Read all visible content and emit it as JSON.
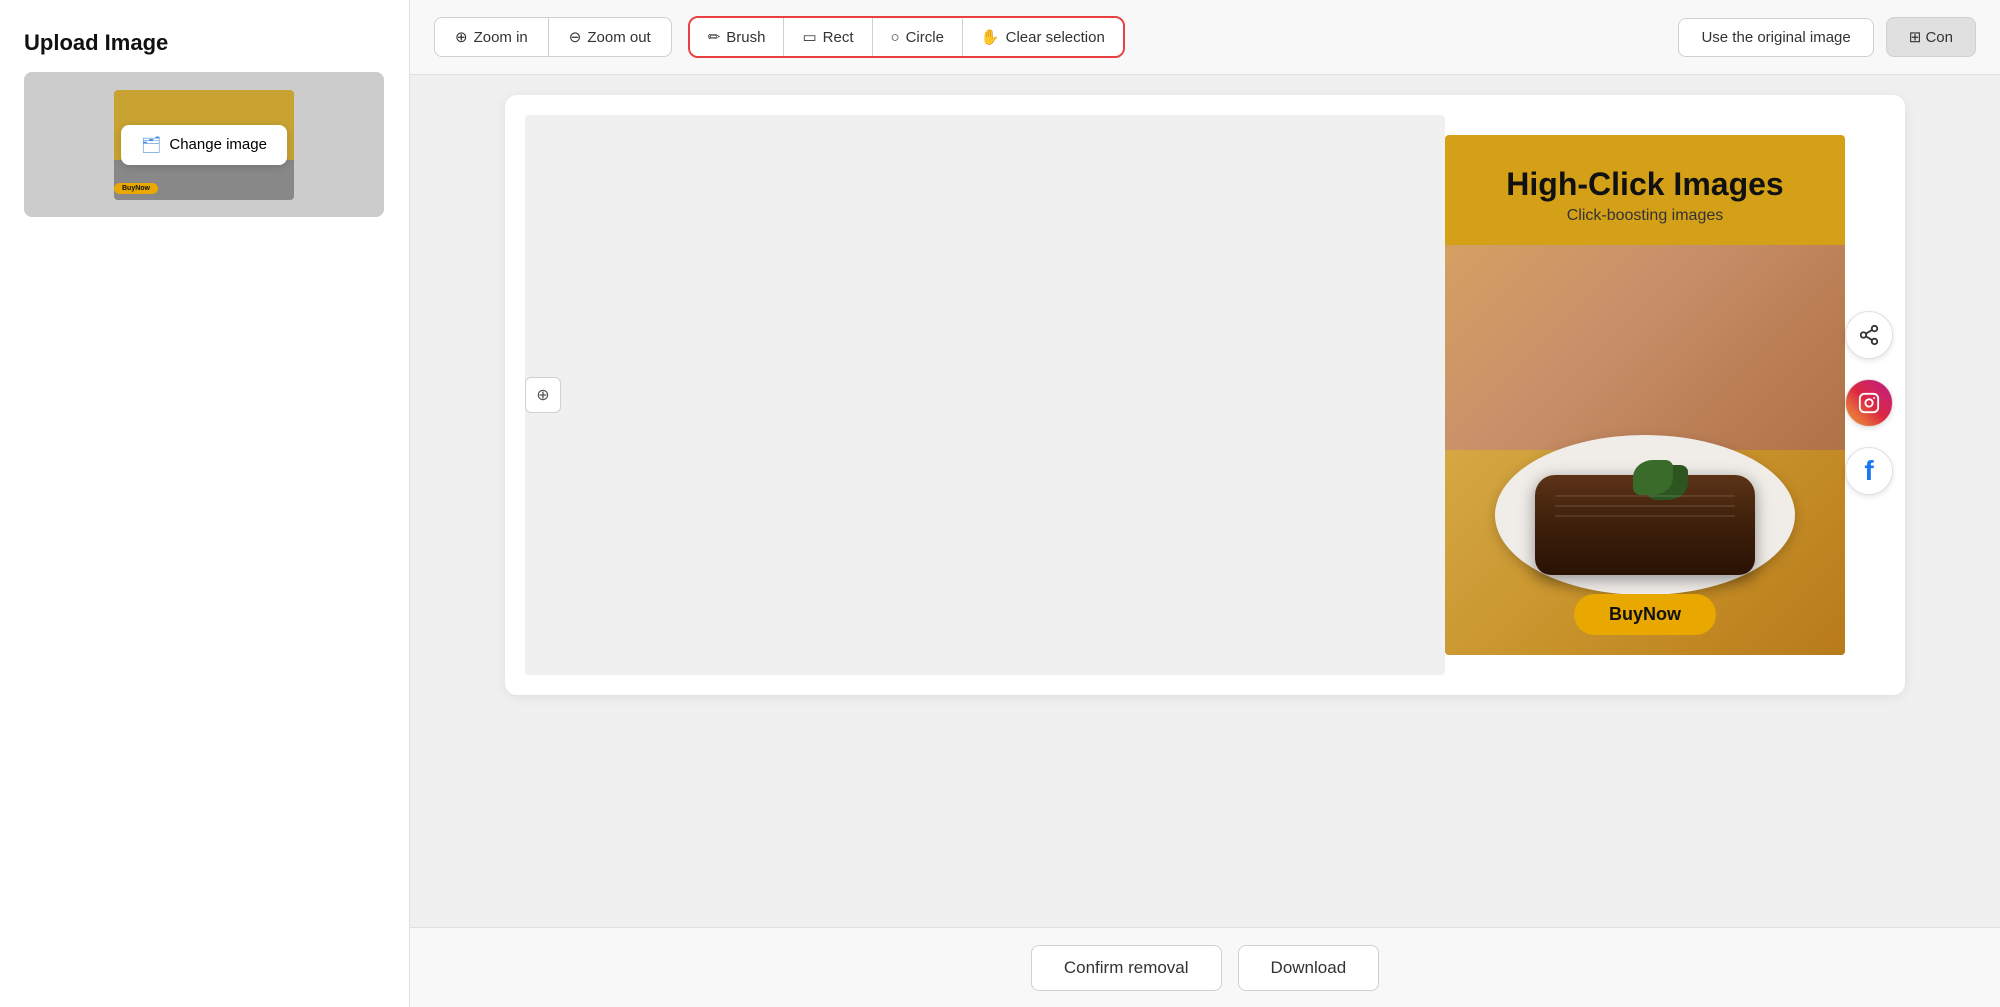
{
  "sidebar": {
    "title": "Upload Image",
    "change_image_label": "Change image"
  },
  "toolbar": {
    "zoom_in_label": "Zoom in",
    "zoom_out_label": "Zoom out",
    "brush_label": "Brush",
    "rect_label": "Rect",
    "circle_label": "Circle",
    "clear_selection_label": "Clear selection",
    "use_original_label": "Use the original image",
    "operation_label": "Con"
  },
  "canvas": {
    "center_icon": "⊕",
    "ad": {
      "title": "High-Click Images",
      "subtitle": "Click-boosting images",
      "buy_now": "BuyNow"
    }
  },
  "social": {
    "share_icon": "share",
    "instagram_icon": "instagram",
    "facebook_icon": "facebook"
  },
  "bottom": {
    "confirm_removal_label": "Confirm removal",
    "download_label": "Download"
  },
  "icons": {
    "zoom_in": "⊕",
    "zoom_out": "⊖",
    "brush": "✏",
    "rect": "▭",
    "circle": "○",
    "clear": "✋",
    "folder": "🗂",
    "center": "⊕"
  }
}
